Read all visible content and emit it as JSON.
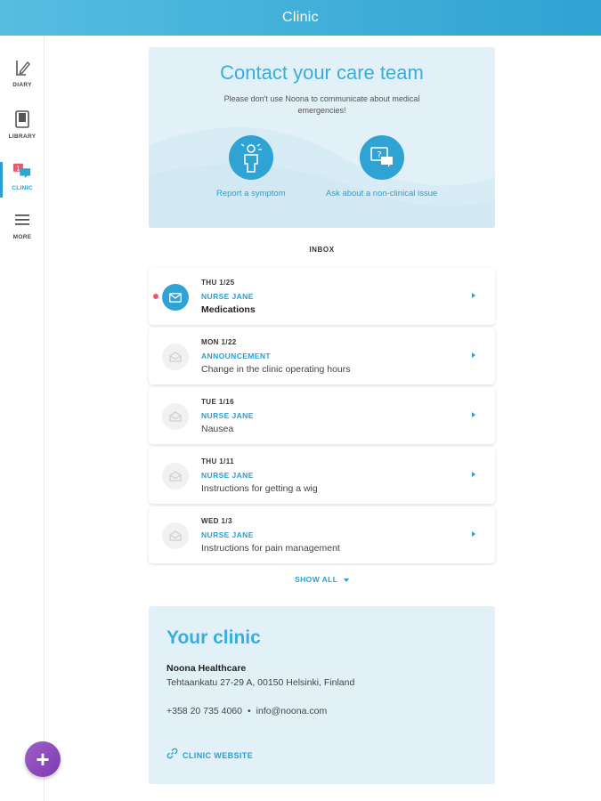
{
  "header": {
    "title": "Clinic"
  },
  "sidebar": {
    "items": [
      {
        "label": "DIARY",
        "icon": "diary-icon"
      },
      {
        "label": "LIBRARY",
        "icon": "library-icon"
      },
      {
        "label": "CLINIC",
        "icon": "clinic-chat-icon",
        "badge": "1",
        "active": true
      },
      {
        "label": "MORE",
        "icon": "menu-icon"
      }
    ],
    "fab_label": "+"
  },
  "contact": {
    "title": "Contact your care team",
    "subtitle": "Please don't use Noona to communicate about medical emergencies!",
    "actions": [
      {
        "label": "Report a symptom",
        "icon": "person-symptom-icon"
      },
      {
        "label": "Ask about a non-clinical issue",
        "icon": "question-chat-icon"
      }
    ]
  },
  "inbox": {
    "title": "INBOX",
    "messages": [
      {
        "date": "THU 1/25",
        "sender": "NURSE JANE",
        "subject": "Medications",
        "unread": true
      },
      {
        "date": "MON 1/22",
        "sender": "ANNOUNCEMENT",
        "subject": "Change in the clinic operating hours",
        "unread": false
      },
      {
        "date": "TUE 1/16",
        "sender": "NURSE JANE",
        "subject": "Nausea",
        "unread": false
      },
      {
        "date": "THU 1/11",
        "sender": "NURSE JANE",
        "subject": "Instructions for getting a wig",
        "unread": false
      },
      {
        "date": "WED 1/3",
        "sender": "NURSE JANE",
        "subject": "Instructions for pain management",
        "unread": false
      }
    ],
    "show_all": "SHOW ALL"
  },
  "clinic": {
    "title": "Your clinic",
    "name": "Noona Healthcare",
    "address": "Tehtaankatu 27-29 A, 00150 Helsinki, Finland",
    "phone": "+358 20 735 4060",
    "separator": "•",
    "email": "info@noona.com",
    "website_label": "CLINIC WEBSITE"
  },
  "colors": {
    "accent": "#2fa3d3",
    "panel": "#e2f1f7",
    "unread_dot": "#f0576a",
    "fab": "#8a47bb"
  }
}
